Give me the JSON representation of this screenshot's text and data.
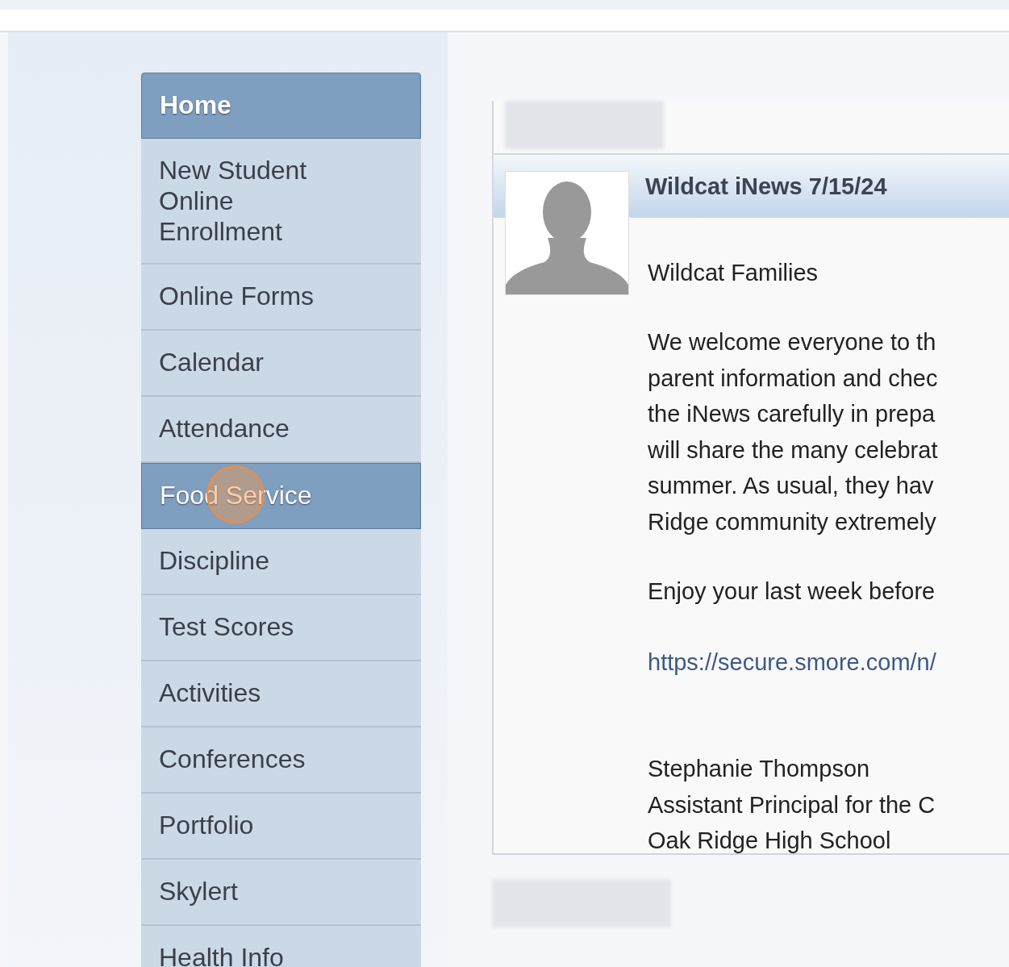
{
  "menu": [
    {
      "label": "Home",
      "selected": true,
      "hovered": false
    },
    {
      "label": "New Student Online Enrollment",
      "selected": false,
      "hovered": false
    },
    {
      "label": "Online Forms",
      "selected": false,
      "hovered": false
    },
    {
      "label": "Calendar",
      "selected": false,
      "hovered": false
    },
    {
      "label": "Attendance",
      "selected": false,
      "hovered": false
    },
    {
      "label": "Food Service",
      "selected": false,
      "hovered": true
    },
    {
      "label": "Discipline",
      "selected": false,
      "hovered": false
    },
    {
      "label": "Test Scores",
      "selected": false,
      "hovered": false
    },
    {
      "label": "Activities",
      "selected": false,
      "hovered": false
    },
    {
      "label": "Conferences",
      "selected": false,
      "hovered": false
    },
    {
      "label": "Portfolio",
      "selected": false,
      "hovered": false
    },
    {
      "label": "Skylert",
      "selected": false,
      "hovered": false
    },
    {
      "label": "Health Info",
      "selected": false,
      "hovered": false
    }
  ],
  "message": {
    "title": "Wildcat iNews 7/15/24",
    "greeting": "Wildcat Families",
    "body": [
      "We welcome everyone to th",
      "parent information and chec",
      "the iNews carefully in prepa",
      "will share the many celebrat",
      "summer.  As usual, they hav",
      "Ridge community extremely"
    ],
    "closing": "Enjoy your last week before",
    "link": "https://secure.smore.com/n/",
    "signature": [
      "Stephanie Thompson",
      "Assistant Principal for the C",
      "Oak Ridge High School"
    ]
  }
}
